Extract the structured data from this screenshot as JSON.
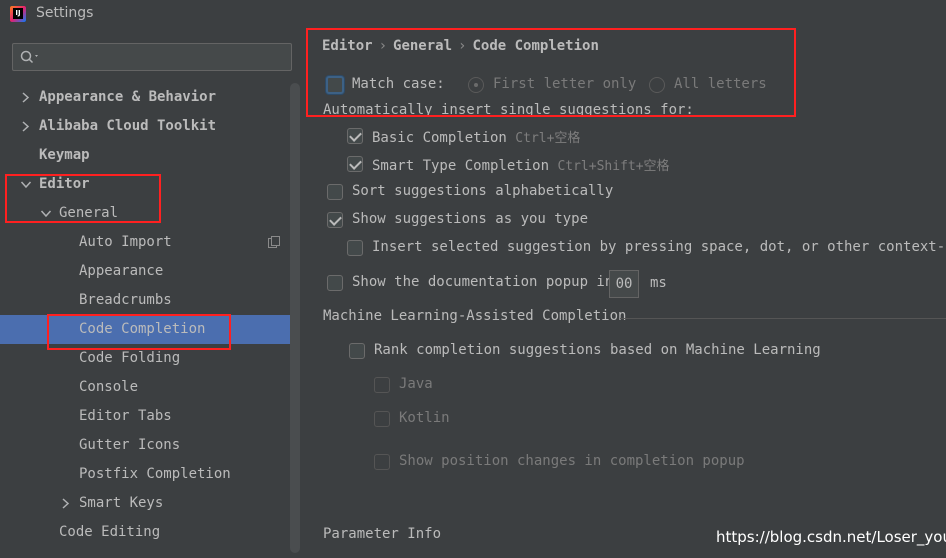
{
  "window": {
    "title": "Settings"
  },
  "search": {
    "placeholder": ""
  },
  "tree": {
    "items": [
      {
        "label": "Appearance & Behavior"
      },
      {
        "label": "Alibaba Cloud Toolkit"
      },
      {
        "label": "Keymap"
      },
      {
        "label": "Editor"
      },
      {
        "label": "General"
      },
      {
        "label": "Auto Import"
      },
      {
        "label": "Appearance"
      },
      {
        "label": "Breadcrumbs"
      },
      {
        "label": "Code Completion"
      },
      {
        "label": "Code Folding"
      },
      {
        "label": "Console"
      },
      {
        "label": "Editor Tabs"
      },
      {
        "label": "Gutter Icons"
      },
      {
        "label": "Postfix Completion"
      },
      {
        "label": "Smart Keys"
      },
      {
        "label": "Code Editing"
      }
    ]
  },
  "breadcrumb": {
    "a": "Editor",
    "b": "General",
    "c": "Code Completion",
    "sep": "›"
  },
  "options": {
    "match_case": "Match case:",
    "first_letter": "First letter only",
    "all_letters": "All letters",
    "auto_insert": "Automatically insert single suggestions for:",
    "basic": "Basic Completion",
    "basic_shortcut": "Ctrl+空格",
    "smart": "Smart Type Completion",
    "smart_shortcut": "Ctrl+Shift+空格",
    "sort": "Sort suggestions alphabetically",
    "show_as_type": "Show suggestions as you type",
    "insert_selected": "Insert selected suggestion by pressing space, dot, or other context-dependent keys",
    "doc_popup": "Show the documentation popup in",
    "doc_popup_value": "00",
    "doc_popup_unit": "ms"
  },
  "ml": {
    "heading": "Machine Learning-Assisted Completion",
    "rank": "Rank completion suggestions based on Machine Learning",
    "java": "Java",
    "kotlin": "Kotlin",
    "show_pos": "Show position changes in completion popup"
  },
  "param_info": {
    "heading": "Parameter Info"
  },
  "watermark": "https://blog.csdn.net/Loser_you",
  "colors": {
    "background": "#3c3f41",
    "selection": "#4b6eaf",
    "highlight_box": "#ff2020"
  }
}
